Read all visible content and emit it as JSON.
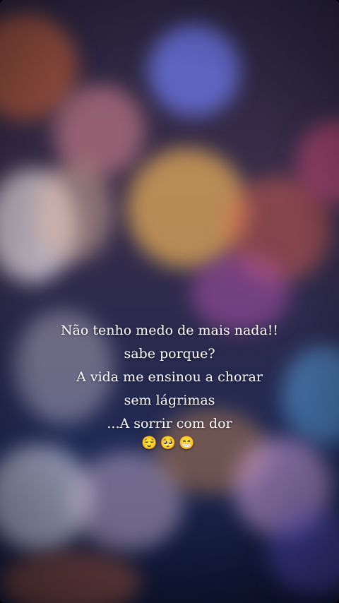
{
  "story": {
    "lines": [
      "Não tenho medo de mais nada!!",
      "sabe porque?",
      "A vida me ensinou a chorar",
      "sem lágrimas",
      "...A sorrir com dor"
    ],
    "emojis": "😌🥺😁"
  },
  "colors": {
    "text": "#ffffff",
    "background_top": "#2a2440",
    "background_bottom": "#0d1430"
  }
}
